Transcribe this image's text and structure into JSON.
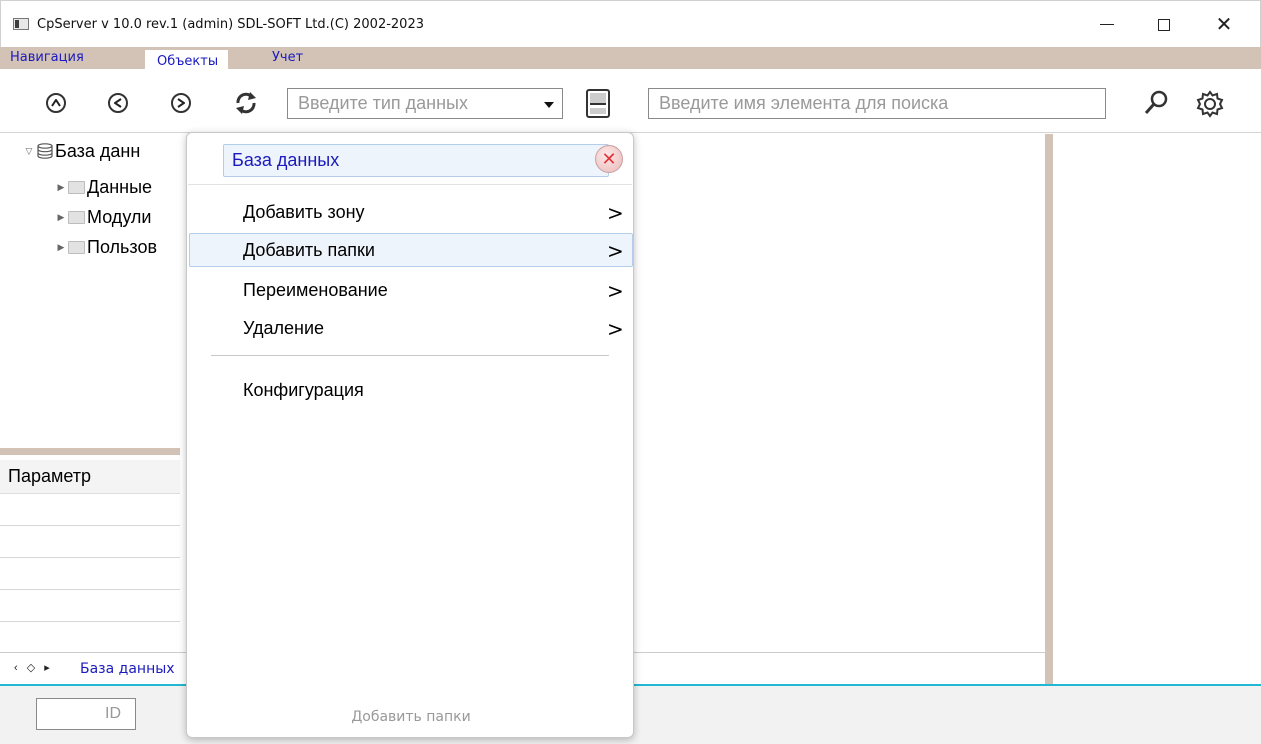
{
  "window": {
    "title": "CpServer v 10.0 rev.1 (admin) SDL-SOFT Ltd.(C) 2002-2023",
    "minimize": "–",
    "maximize": "☐",
    "close": "✕"
  },
  "menu_tabs": {
    "navigation": "Навигация",
    "objects": "Объекты",
    "accounting": "Учет",
    "active": "objects"
  },
  "toolbar": {
    "up_glyph": "⌃",
    "back_glyph": "<",
    "forward_glyph": ">",
    "refresh_glyph": "⟳",
    "type_placeholder": "Введите тип данных",
    "search_placeholder": "Введите имя элемента для поиска"
  },
  "tree": {
    "root": "База данн",
    "children": [
      "Данные",
      "Модули",
      "Пользов"
    ]
  },
  "params": {
    "header": "Параметр"
  },
  "bottom_tabs": {
    "nav_arrows": "‹ ◇ ▸",
    "tab_label": "База данных"
  },
  "status": {
    "id_placeholder": "ID"
  },
  "popup": {
    "title": "База данных",
    "close_glyph": "✕",
    "items": [
      {
        "label": "Добавить зону",
        "arrow": ">"
      },
      {
        "label": "Добавить папки",
        "arrow": ">"
      },
      {
        "label": "Переименование",
        "arrow": ">"
      },
      {
        "label": "Удаление",
        "arrow": ">"
      }
    ],
    "config_label": "Конфигурация",
    "status_text": "Добавить папки"
  },
  "colors": {
    "accent_blue": "#1a1abf",
    "menubar": "#d3c3b6",
    "divider_cyan": "#22b7d2",
    "highlight_bg": "#eef4fb",
    "highlight_border": "#b4cde8"
  }
}
